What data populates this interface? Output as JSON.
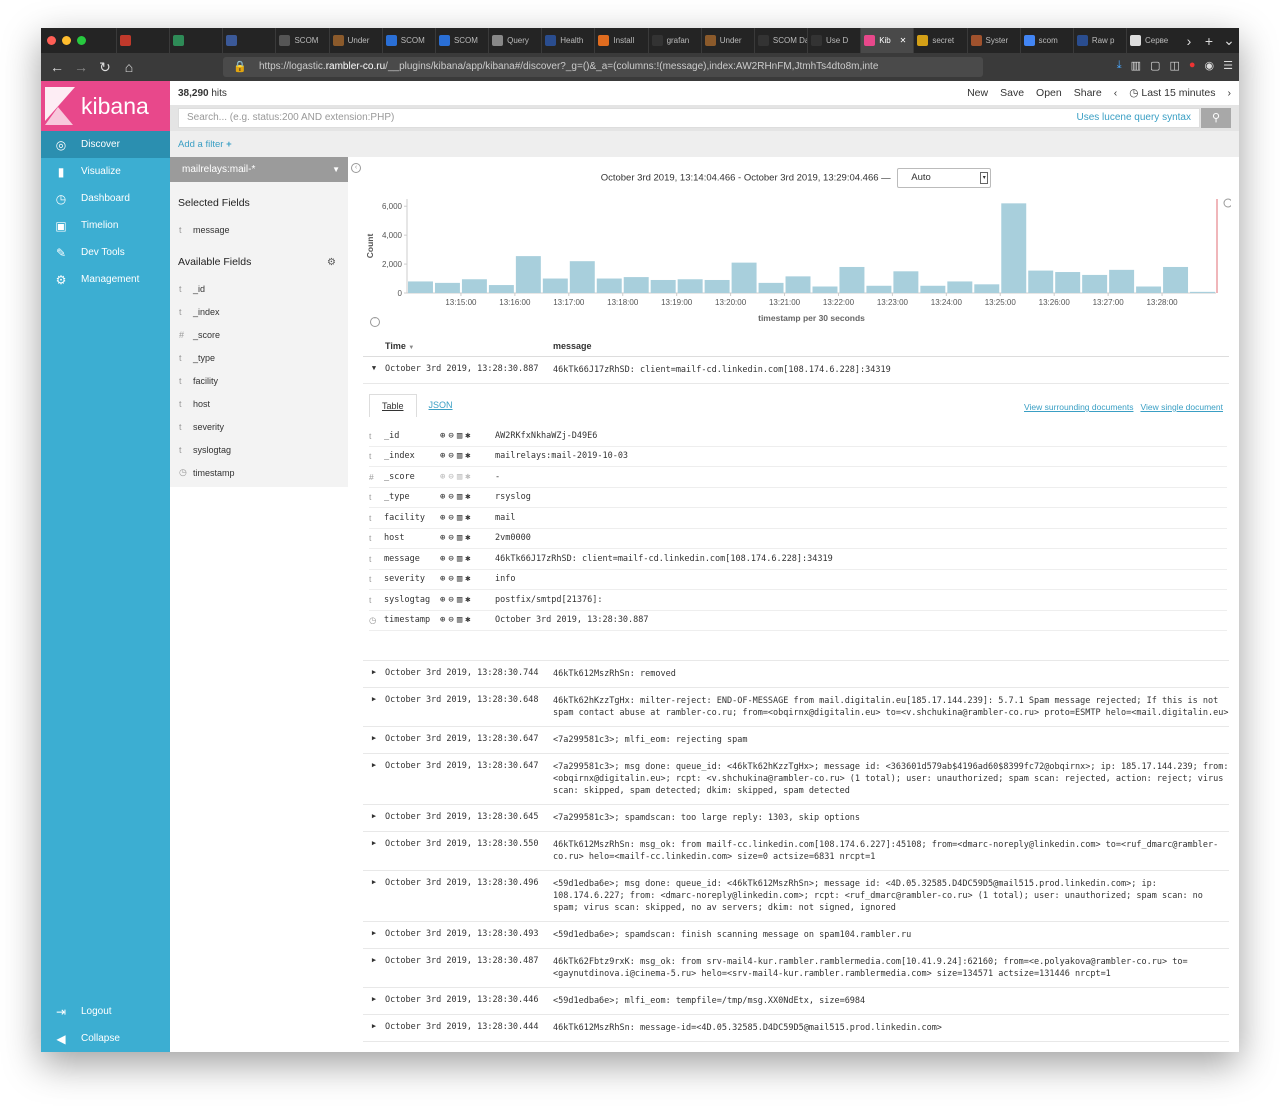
{
  "browser": {
    "tabs": [
      {
        "label": "",
        "color": "#c0392b",
        "active": false
      },
      {
        "label": "",
        "color": "#2e8b57",
        "active": false
      },
      {
        "label": "",
        "color": "#3b5998",
        "active": false
      },
      {
        "label": "SCOM",
        "color": "#555",
        "active": false
      },
      {
        "label": "Under",
        "color": "#8b5a2b",
        "active": false
      },
      {
        "label": "SCOM",
        "color": "#2a6fd6",
        "active": false
      },
      {
        "label": "SCOM",
        "color": "#2a6fd6",
        "active": false
      },
      {
        "label": "Query",
        "color": "#888",
        "active": false
      },
      {
        "label": "Health",
        "color": "#2a4d8f",
        "active": false
      },
      {
        "label": "Install",
        "color": "#e06c1f",
        "active": false
      },
      {
        "label": "grafan",
        "color": "#333",
        "active": false
      },
      {
        "label": "Under",
        "color": "#8b5a2b",
        "active": false
      },
      {
        "label": "SCOM Dat",
        "color": "#333",
        "active": false
      },
      {
        "label": "Use D",
        "color": "#333",
        "active": false
      },
      {
        "label": "Kib",
        "color": "#e8488b",
        "active": true
      },
      {
        "label": "secret",
        "color": "#d4a017",
        "active": false
      },
      {
        "label": "Syster",
        "color": "#a0522d",
        "active": false
      },
      {
        "label": "scom",
        "color": "#4285f4",
        "active": false
      },
      {
        "label": "Raw p",
        "color": "#2a4d8f",
        "active": false
      },
      {
        "label": "Серве",
        "color": "#ddd",
        "active": false
      }
    ],
    "url_prefix": "https://logastic.",
    "url_domain": "rambler-co.ru",
    "url_rest": "/__plugins/kibana/app/kibana#/discover?_g=()&_a=(columns:!(message),index:AW2RHnFM,JtmhTs4dto8m,inte"
  },
  "sidebar": {
    "logo": "kibana",
    "items": [
      {
        "label": "Discover",
        "icon": "compass-icon",
        "glyph": "◎"
      },
      {
        "label": "Visualize",
        "icon": "bar-chart-icon",
        "glyph": "▮"
      },
      {
        "label": "Dashboard",
        "icon": "dashboard-icon",
        "glyph": "◷"
      },
      {
        "label": "Timelion",
        "icon": "timelion-icon",
        "glyph": "▣"
      },
      {
        "label": "Dev Tools",
        "icon": "wrench-icon",
        "glyph": "✎"
      },
      {
        "label": "Management",
        "icon": "gear-icon",
        "glyph": "⚙"
      }
    ],
    "logout": "Logout",
    "collapse": "Collapse"
  },
  "header": {
    "hits_count": "38,290",
    "hits_label": " hits",
    "menu": {
      "new": "New",
      "save": "Save",
      "open": "Open",
      "share": "Share",
      "time": "Last 15 minutes"
    }
  },
  "search": {
    "placeholder": "Search... (e.g. status:200 AND extension:PHP)",
    "lucene": "Uses lucene query syntax"
  },
  "filters": {
    "add": "Add a filter"
  },
  "fields": {
    "index_pattern": "mailrelays:mail-*",
    "selected_title": "Selected Fields",
    "selected": [
      {
        "type": "t",
        "name": "message"
      }
    ],
    "available_title": "Available Fields",
    "available": [
      {
        "type": "t",
        "name": "_id"
      },
      {
        "type": "t",
        "name": "_index"
      },
      {
        "type": "#",
        "name": "_score"
      },
      {
        "type": "t",
        "name": "_type"
      },
      {
        "type": "t",
        "name": "facility"
      },
      {
        "type": "t",
        "name": "host"
      },
      {
        "type": "t",
        "name": "severity"
      },
      {
        "type": "t",
        "name": "syslogtag"
      },
      {
        "type": "◷",
        "name": "timestamp"
      }
    ]
  },
  "time_range": {
    "text": "October 3rd 2019, 13:14:04.466 - October 3rd 2019, 13:29:04.466 —",
    "interval": "Auto"
  },
  "chart_data": {
    "type": "bar",
    "ylabel": "Count",
    "xlabel": "timestamp per 30 seconds",
    "ylim": [
      0,
      6500
    ],
    "yticks": [
      0,
      2000,
      4000,
      6000
    ],
    "ytick_labels": [
      "0",
      "2,000",
      "4,000",
      "6,000"
    ],
    "xtick_labels": [
      "13:15:00",
      "13:16:00",
      "13:17:00",
      "13:18:00",
      "13:19:00",
      "13:20:00",
      "13:21:00",
      "13:22:00",
      "13:23:00",
      "13:24:00",
      "13:25:00",
      "13:26:00",
      "13:27:00",
      "13:28:00"
    ],
    "values": [
      800,
      700,
      950,
      550,
      2550,
      1000,
      2200,
      1000,
      1100,
      900,
      950,
      900,
      2100,
      700,
      1150,
      450,
      1800,
      500,
      1500,
      500,
      800,
      600,
      6200,
      1550,
      1450,
      1250,
      1600,
      450,
      1800,
      80
    ],
    "color": "#a8cfdc"
  },
  "table": {
    "col_time": "Time",
    "col_message": "message",
    "expanded_row": {
      "time": "October 3rd 2019, 13:28:30.887",
      "message": "46kTk66J17zRhSD: client=mailf-cd.linkedin.com[108.174.6.228]:34319",
      "tab_table": "Table",
      "tab_json": "JSON",
      "link_surrounding": "View surrounding documents",
      "link_single": "View single document",
      "fields": [
        {
          "type": "t",
          "name": "_id",
          "value": "AW2RKfxNkhaWZj-D49E6",
          "dim": false
        },
        {
          "type": "t",
          "name": "_index",
          "value": "mailrelays:mail-2019-10-03",
          "dim": false
        },
        {
          "type": "#",
          "name": "_score",
          "value": " -",
          "dim": true
        },
        {
          "type": "t",
          "name": "_type",
          "value": "rsyslog",
          "dim": false
        },
        {
          "type": "t",
          "name": "facility",
          "value": "mail",
          "dim": false
        },
        {
          "type": "t",
          "name": "host",
          "value": "2vm0000",
          "dim": false
        },
        {
          "type": "t",
          "name": "message",
          "value": "46kTk66J17zRhSD: client=mailf-cd.linkedin.com[108.174.6.228]:34319",
          "dim": false
        },
        {
          "type": "t",
          "name": "severity",
          "value": "info",
          "dim": false
        },
        {
          "type": "t",
          "name": "syslogtag",
          "value": "postfix/smtpd[21376]:",
          "dim": false
        },
        {
          "type": "◷",
          "name": "timestamp",
          "value": "October 3rd 2019, 13:28:30.887",
          "dim": false
        }
      ]
    },
    "rows": [
      {
        "time": "October 3rd 2019, 13:28:30.744",
        "message": "46kTk612MszRhSn: removed"
      },
      {
        "time": "October 3rd 2019, 13:28:30.648",
        "message": "46kTk62hKzzTgHx: milter-reject: END-OF-MESSAGE from mail.digitalin.eu[185.17.144.239]: 5.7.1 Spam message rejected; If this is not spam contact abuse at rambler-co.ru; from=<obqirnx@digitalin.eu> to=<v.shchukina@rambler-co.ru> proto=ESMTP helo=<mail.digitalin.eu>"
      },
      {
        "time": "October 3rd 2019, 13:28:30.647",
        "message": "<7a299581c3>; mlfi_eom: rejecting spam"
      },
      {
        "time": "October 3rd 2019, 13:28:30.647",
        "message": "<7a299581c3>; msg done: queue_id: <46kTk62hKzzTgHx>; message id: <363601d579ab$4196ad60$8399fc72@obqirnx>; ip: 185.17.144.239; from: <obqirnx@digitalin.eu>; rcpt: <v.shchukina@rambler-co.ru> (1 total); user: unauthorized; spam scan: rejected, action: reject; virus scan: skipped, spam detected; dkim: skipped, spam detected"
      },
      {
        "time": "October 3rd 2019, 13:28:30.645",
        "message": "<7a299581c3>; spamdscan: too large reply: 1303, skip options"
      },
      {
        "time": "October 3rd 2019, 13:28:30.550",
        "message": "46kTk612MszRhSn: msg_ok: from mailf-cc.linkedin.com[108.174.6.227]:45108; from=<dmarc-noreply@linkedin.com> to=<ruf_dmarc@rambler-co.ru> helo=<mailf-cc.linkedin.com> size=0 actsize=6831 nrcpt=1"
      },
      {
        "time": "October 3rd 2019, 13:28:30.496",
        "message": "<59d1edba6e>; msg done: queue_id: <46kTk612MszRhSn>; message id: <4D.05.32585.D4DC59D5@mail515.prod.linkedin.com>; ip: 108.174.6.227; from: <dmarc-noreply@linkedin.com>; rcpt: <ruf_dmarc@rambler-co.ru> (1 total); user: unauthorized; spam scan: no spam; virus scan: skipped, no av servers; dkim: not signed, ignored"
      },
      {
        "time": "October 3rd 2019, 13:28:30.493",
        "message": "<59d1edba6e>; spamdscan: finish scanning message on spam104.rambler.ru"
      },
      {
        "time": "October 3rd 2019, 13:28:30.487",
        "message": "46kTk62Fbtz9rxK: msg_ok: from srv-mail4-kur.rambler.ramblermedia.com[10.41.9.24]:62160; from=<e.polyakova@rambler-co.ru> to=<gaynutdinova.i@cinema-5.ru> helo=<srv-mail4-kur.rambler.ramblermedia.com> size=134571 actsize=131446 nrcpt=1"
      },
      {
        "time": "October 3rd 2019, 13:28:30.446",
        "message": "<59d1edba6e>; mlfi_eom: tempfile=/tmp/msg.XX0NdEtx, size=6984"
      },
      {
        "time": "October 3rd 2019, 13:28:30.444",
        "message": "46kTk612MszRhSn: message-id=<4D.05.32585.D4DC59D5@mail515.prod.linkedin.com>"
      }
    ]
  }
}
